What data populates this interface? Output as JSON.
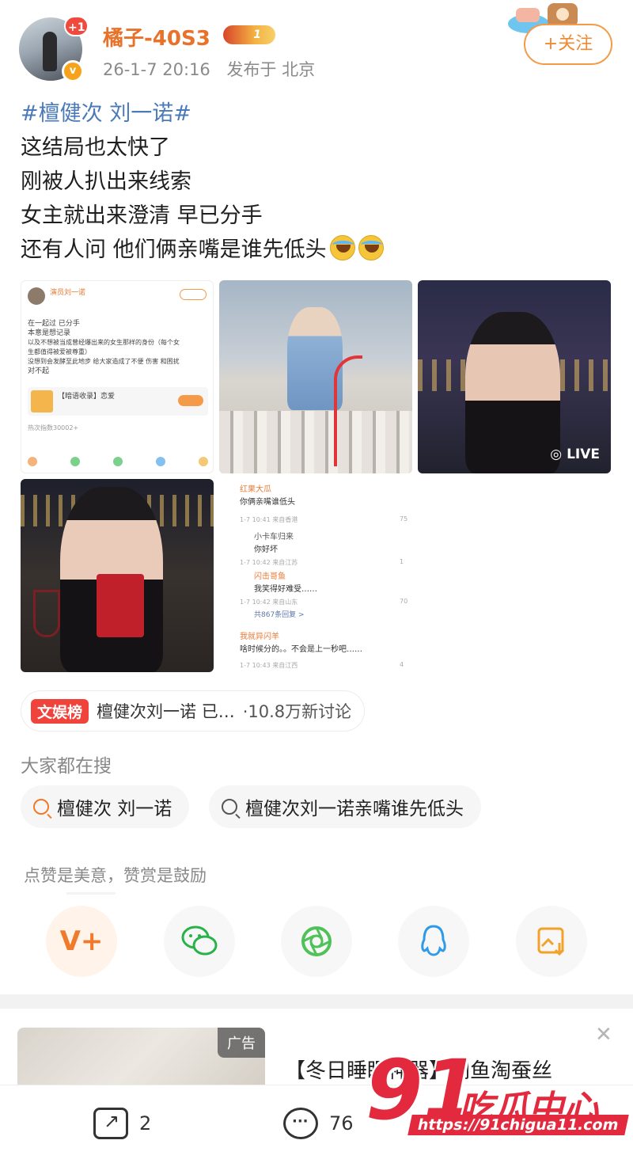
{
  "header": {
    "avatar_badge": "+1",
    "username": "橘子-40S3",
    "level": "1",
    "timestamp": "26-1-7 20:16",
    "location": "发布于 北京",
    "follow_label": "+关注"
  },
  "post": {
    "topic": "#檀健次 刘一诺#",
    "lines": [
      "这结局也太快了",
      "刚被人扒出来线索",
      "女主就出来澄清 早已分手",
      "还有人问 他们俩亲嘴是谁先低头"
    ]
  },
  "images": {
    "img1": {
      "author": "演员刘一诺",
      "lines": [
        "在一起过 已分手",
        "本意是想记录",
        "以及不想被当成曾经爆出来的女生那样的身份（每个女",
        "生都值得被爱被尊重）",
        "没想到会发酵至此地步 给大家造成了不便 伤害 和困扰",
        "对不起"
      ],
      "card": "【暗语收录】恋爱",
      "hot": "热次指数30002+"
    },
    "img3": {
      "live": "LIVE"
    },
    "img5": {
      "c1_name": "红果大瓜",
      "c1_text": "你俩亲嘴谁低头",
      "c1_meta": "1-7 10:41 来自香港",
      "c1_likes": "75",
      "c2_name": "小卡车归来",
      "c2_text": "你好坏",
      "c2_meta": "1-7 10:42 来自江苏",
      "c2_likes": "1",
      "c3_name": "闪击哥鱼",
      "c3_text": "我笑得好难受……",
      "c3_meta": "1-7 10:42 来自山东",
      "c3_likes": "70",
      "c3_more": "共867条回复 >",
      "c4_name": "我就异闪羊",
      "c4_text": "啥时候分的。。不会是上一秒吧……",
      "c4_meta": "1-7 10:43 来自江西",
      "c4_likes": "4"
    }
  },
  "hot_topic": {
    "tag": "文娱榜",
    "text": "檀健次刘一诺 已…",
    "count": "·10.8万新讨论"
  },
  "search": {
    "title": "大家都在搜",
    "chips": [
      "檀健次 刘一诺",
      "檀健次刘一诺亲嘴谁先低头"
    ]
  },
  "reward": {
    "text": "点赞是美意，赞赏是鼓励"
  },
  "share": {
    "icons": [
      "weibo-v-plus-icon",
      "wechat-icon",
      "moments-icon",
      "qq-icon",
      "save-image-icon"
    ],
    "colors": [
      "#f07a2c",
      "#28b34a",
      "#4fc159",
      "#2f9ae8",
      "#f2a22a"
    ]
  },
  "ad": {
    "tag": "广告",
    "title": "【冬日睡眠神器】闲鱼淘蚕丝"
  },
  "bottom": {
    "repost_count": "2",
    "comment_count": "76"
  },
  "watermark": {
    "number": "91",
    "text": "吃瓜中心",
    "url": "https://91chigua11.com"
  }
}
